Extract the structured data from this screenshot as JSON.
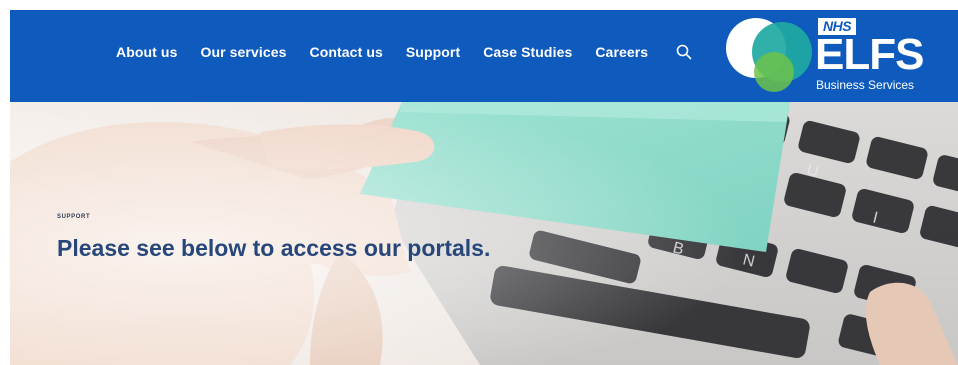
{
  "nav": {
    "items": [
      {
        "label": "About us"
      },
      {
        "label": "Our services"
      },
      {
        "label": "Contact us"
      },
      {
        "label": "Support"
      },
      {
        "label": "Case Studies"
      },
      {
        "label": "Careers"
      }
    ],
    "search_icon": "search-icon"
  },
  "logo": {
    "nhs": "NHS",
    "name": "ELFS",
    "tagline": "Business Services"
  },
  "hero": {
    "eyebrow": "SUPPORT",
    "title": "Please see below to access our portals."
  },
  "colors": {
    "brand_blue": "#0f5bbd",
    "title_blue": "#27477a",
    "card_teal": "#8fdcca"
  }
}
